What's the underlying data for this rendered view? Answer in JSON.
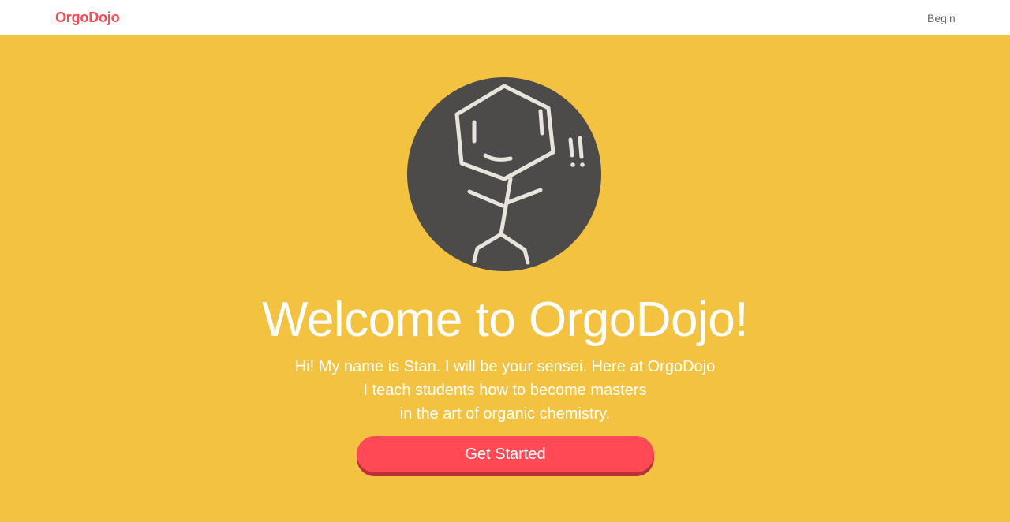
{
  "navbar": {
    "brand": "OrgoDojo",
    "begin_label": "Begin"
  },
  "hero": {
    "avatar_icon": "stick-figure-molecule-icon",
    "title": "Welcome to OrgoDojo!",
    "intro_lines": [
      "Hi! My name is Stan. I will be your sensei. Here at OrgoDojo",
      "I teach students how to become masters",
      "in the art of organic chemistry."
    ],
    "cta_label": "Get Started"
  },
  "colors": {
    "brand": "#ff4a55",
    "hero_bg": "#f3c241",
    "avatar_bg": "#4d4a4a",
    "text_light": "#ffffff"
  }
}
